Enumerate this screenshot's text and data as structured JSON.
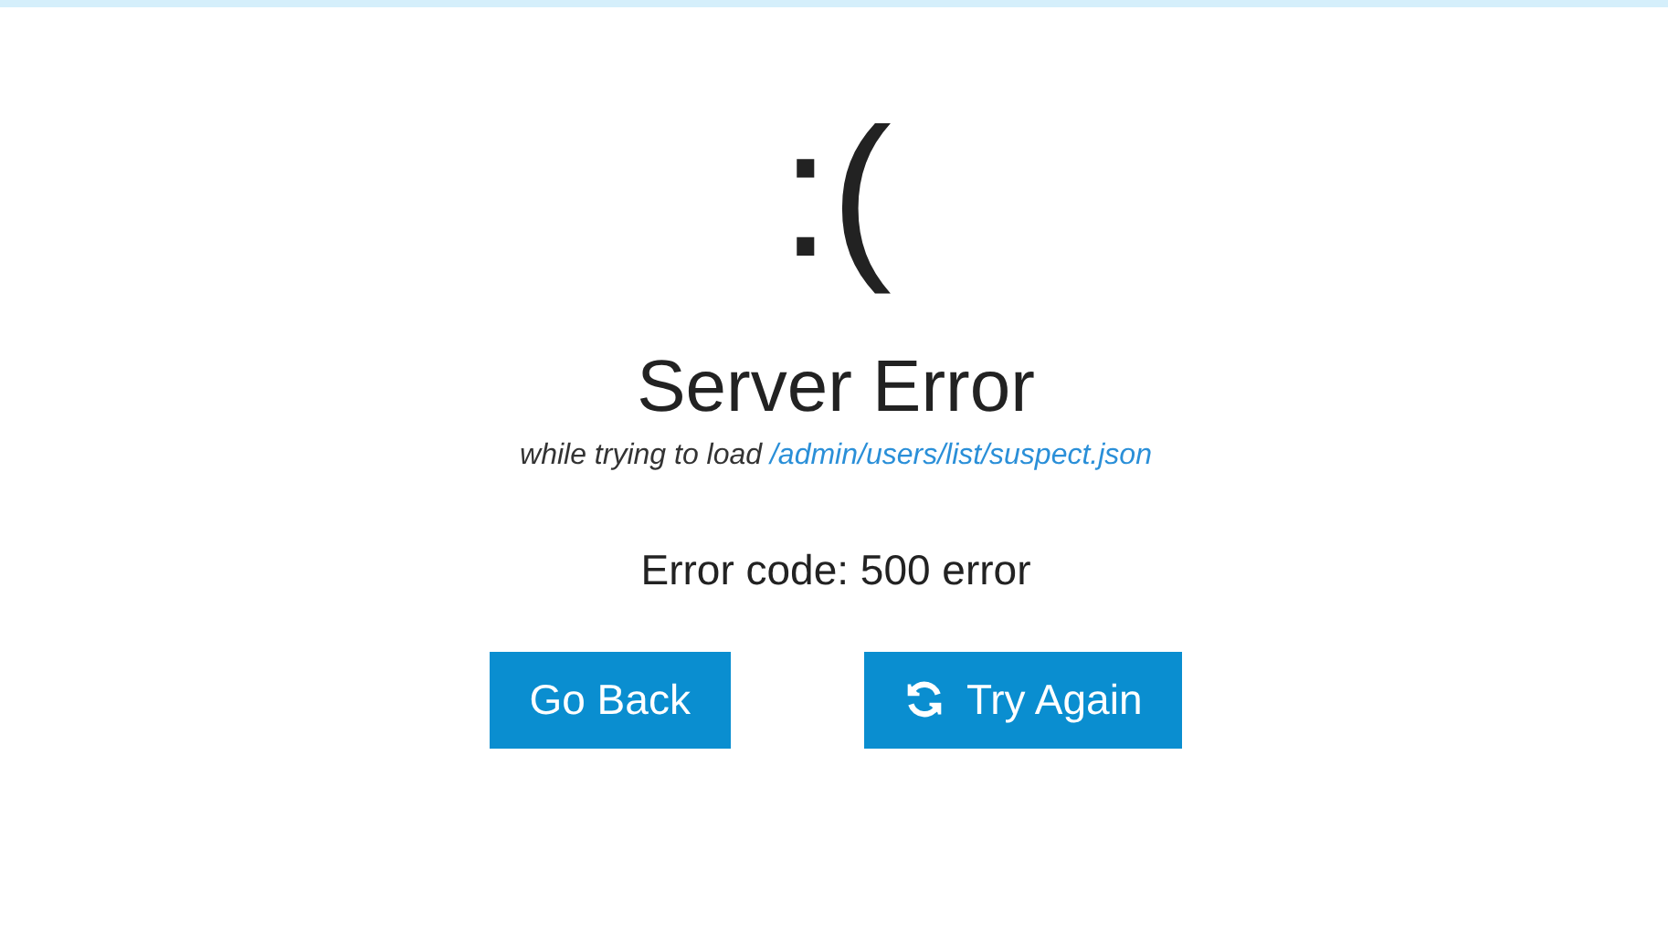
{
  "face": ":(",
  "title": "Server Error",
  "detail": {
    "text": "while trying to load",
    "link": "/admin/users/list/suspect.json"
  },
  "error_code": "Error code: 500 error",
  "buttons": [
    {
      "label": "Go Back",
      "kind": "plain"
    },
    {
      "label": "Try Again",
      "kind": "retry"
    }
  ]
}
